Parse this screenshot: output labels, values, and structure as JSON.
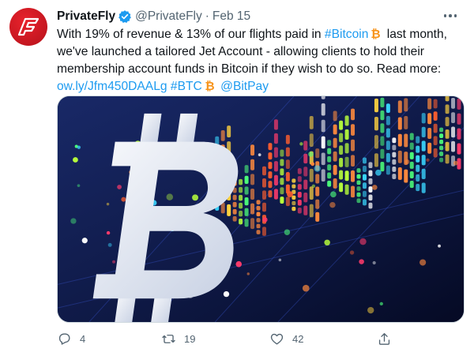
{
  "tweet": {
    "author_name": "PrivateFly",
    "handle": "@PrivateFly",
    "separator": "·",
    "date": "Feb 15",
    "text": {
      "line1_part1": "With 19% of revenue & 13% of our flights paid in ",
      "line1_hashtag": "#Bitcoin",
      "line1_part2": " last month,",
      "line2": "we've launched a tailored Jet Account - allowing clients to hold their",
      "line3": "membership account funds in Bitcoin if they wish to do so. Read more:",
      "line4_link": "ow.ly/Jfm450DAALg",
      "line4_hashtag": "#BTC",
      "line4_mention": "@BitPay"
    },
    "media_description_icon": "bitcoin-chart-image"
  },
  "actions": {
    "reply_count": "4",
    "retweet_count": "19",
    "like_count": "42"
  },
  "colors": {
    "link": "#1d9bf0",
    "secondary_text": "#536471",
    "brand_red": "#d51a23",
    "bitcoin_orange": "#f7931a"
  }
}
